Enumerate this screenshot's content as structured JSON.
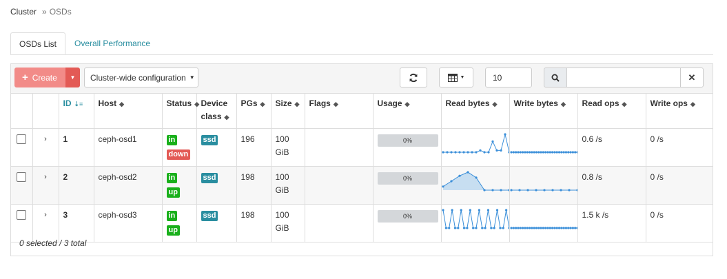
{
  "breadcrumb": {
    "root": "Cluster",
    "separator": "»",
    "current": "OSDs"
  },
  "tabs": [
    {
      "label": "OSDs List"
    },
    {
      "label": "Overall Performance"
    }
  ],
  "toolbar": {
    "create_label": "Create",
    "cluster_config_label": "Cluster-wide configuration",
    "page_size": "10",
    "search_placeholder": ""
  },
  "table": {
    "headers": {
      "id": "ID",
      "host": "Host",
      "status": "Status",
      "device_class": "Device class",
      "pgs": "PGs",
      "size": "Size",
      "flags": "Flags",
      "usage": "Usage",
      "read_bytes": "Read bytes",
      "write_bytes": "Write bytes",
      "read_ops": "Read ops",
      "write_ops": "Write ops"
    },
    "rows": [
      {
        "id": "1",
        "host": "ceph-osd1",
        "status1": "in",
        "status2": "down",
        "device_class": "ssd",
        "pgs": "196",
        "size_line1": "100",
        "size_line2": "GiB",
        "flags": "",
        "usage": "0%",
        "read_ops": "0.6 /s",
        "write_ops": "0 /s",
        "read_bytes_series": [
          0,
          0,
          0,
          0,
          0,
          0,
          0,
          0,
          0,
          0.1,
          0,
          0,
          0.6,
          0.1,
          0.1,
          1,
          0
        ],
        "write_bytes_series": [
          0,
          0,
          0,
          0,
          0,
          0,
          0,
          0,
          0,
          0,
          0,
          0,
          0,
          0,
          0,
          0,
          0,
          0,
          0,
          0,
          0,
          0,
          0,
          0,
          0,
          0,
          0,
          0,
          0,
          0
        ]
      },
      {
        "id": "2",
        "host": "ceph-osd2",
        "status1": "in",
        "status2": "up",
        "device_class": "ssd",
        "pgs": "198",
        "size_line1": "100",
        "size_line2": "GiB",
        "flags": "",
        "usage": "0%",
        "read_ops": "0.8 /s",
        "write_ops": "0 /s",
        "read_bytes_series": [
          0.2,
          0.5,
          0.8,
          1,
          0.7,
          0,
          0,
          0,
          0
        ],
        "write_bytes_series": [
          0,
          0,
          0,
          0,
          0,
          0,
          0,
          0,
          0
        ]
      },
      {
        "id": "3",
        "host": "ceph-osd3",
        "status1": "in",
        "status2": "up",
        "device_class": "ssd",
        "pgs": "198",
        "size_line1": "100",
        "size_line2": "GiB",
        "flags": "",
        "usage": "0%",
        "read_ops": "1.5 k /s",
        "write_ops": "0 /s",
        "read_bytes_series": [
          1,
          0,
          0,
          1,
          0,
          0,
          1,
          0,
          0,
          1,
          0,
          0,
          1,
          0,
          0,
          1,
          0,
          0,
          1,
          0,
          0,
          1,
          0
        ],
        "write_bytes_series": [
          0,
          0,
          0,
          0,
          0,
          0,
          0,
          0,
          0,
          0,
          0,
          0,
          0,
          0,
          0,
          0,
          0,
          0,
          0,
          0,
          0,
          0,
          0,
          0,
          0,
          0,
          0,
          0,
          0,
          0
        ]
      }
    ]
  },
  "footer": {
    "summary": "0 selected / 3 total"
  },
  "colors": {
    "accent": "#2a8ea0",
    "danger": "#e35a55",
    "success": "#19b01b",
    "spark": "#3b8fd9",
    "spark_fill": "#c7def1"
  },
  "icons": {
    "refresh": "refresh-icon",
    "columns": "table-columns-icon",
    "search": "search-icon",
    "clear": "close-icon",
    "sort": "sort-icon",
    "expand": "chevron-right-icon"
  }
}
